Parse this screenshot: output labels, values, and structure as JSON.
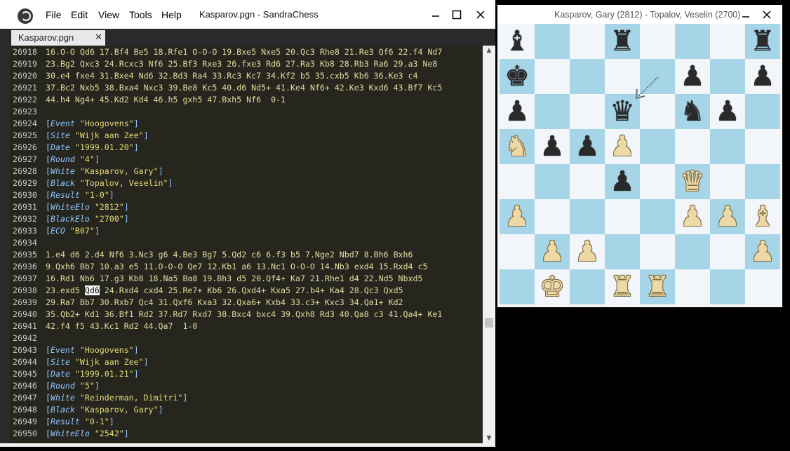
{
  "editor": {
    "title": "Kasparov.pgn - SandraChess",
    "menu": [
      "File",
      "Edit",
      "View",
      "Tools",
      "Help"
    ],
    "tab": {
      "label": "Kasparov.pgn",
      "close": "✕"
    },
    "lines": [
      {
        "n": "26918",
        "t": "16.O-O Qd6 17.Bf4 Be5 18.Rfe1 O-O-O 19.Bxe5 Nxe5 20.Qc3 Rhe8 21.Re3 Qf6 22.f4 Nd7"
      },
      {
        "n": "26919",
        "t": "23.Bg2 Qxc3 24.Rcxc3 Nf6 25.Bf3 Rxe3 26.fxe3 Rd6 27.Ra3 Kb8 28.Rb3 Ra6 29.a3 Ne8"
      },
      {
        "n": "26920",
        "t": "30.e4 fxe4 31.Bxe4 Nd6 32.Bd3 Ra4 33.Rc3 Kc7 34.Kf2 b5 35.cxb5 Kb6 36.Ke3 c4"
      },
      {
        "n": "26921",
        "t": "37.Bc2 Nxb5 38.Bxa4 Nxc3 39.Be8 Kc5 40.d6 Nd5+ 41.Ke4 Nf6+ 42.Ke3 Kxd6 43.Bf7 Kc5"
      },
      {
        "n": "26922",
        "t": "44.h4 Ng4+ 45.Kd2 Kd4 46.h5 gxh5 47.Bxh5 Nf6  0-1"
      },
      {
        "n": "26923",
        "t": ""
      },
      {
        "n": "26924",
        "tag": "Event",
        "val": "\"Hoogovens\""
      },
      {
        "n": "26925",
        "tag": "Site",
        "val": "\"Wijk aan Zee\""
      },
      {
        "n": "26926",
        "tag": "Date",
        "val": "\"1999.01.20\""
      },
      {
        "n": "26927",
        "tag": "Round",
        "val": "\"4\""
      },
      {
        "n": "26928",
        "tag": "White",
        "val": "\"Kasparov, Gary\""
      },
      {
        "n": "26929",
        "tag": "Black",
        "val": "\"Topalov, Veselin\""
      },
      {
        "n": "26930",
        "tag": "Result",
        "val": "\"1-0\""
      },
      {
        "n": "26931",
        "tag": "WhiteElo",
        "val": "\"2812\""
      },
      {
        "n": "26932",
        "tag": "BlackElo",
        "val": "\"2700\""
      },
      {
        "n": "26933",
        "tag": "ECO",
        "val": "\"B07\""
      },
      {
        "n": "26934",
        "t": ""
      },
      {
        "n": "26935",
        "t": "1.e4 d6 2.d4 Nf6 3.Nc3 g6 4.Be3 Bg7 5.Qd2 c6 6.f3 b5 7.Nge2 Nbd7 8.Bh6 Bxh6"
      },
      {
        "n": "26936",
        "t": "9.Qxh6 Bb7 10.a3 e5 11.O-O-O Qe7 12.Kb1 a6 13.Nc1 O-O-O 14.Nb3 exd4 15.Rxd4 c5"
      },
      {
        "n": "26937",
        "t": "16.Rd1 Nb6 17.g3 Kb8 18.Na5 Ba8 19.Bh3 d5 20.Qf4+ Ka7 21.Rhe1 d4 22.Nd5 Nbxd5"
      },
      {
        "n": "26938",
        "pre": "23.exd5 ",
        "hl": "Qd6",
        "post": " 24.Rxd4 cxd4 25.Re7+ Kb6 26.Qxd4+ Kxa5 27.b4+ Ka4 28.Qc3 Qxd5"
      },
      {
        "n": "26939",
        "t": "29.Ra7 Bb7 30.Rxb7 Qc4 31.Qxf6 Kxa3 32.Qxa6+ Kxb4 33.c3+ Kxc3 34.Qa1+ Kd2"
      },
      {
        "n": "26940",
        "t": "35.Qb2+ Kd1 36.Bf1 Rd2 37.Rd7 Rxd7 38.Bxc4 bxc4 39.Qxh8 Rd3 40.Qa8 c3 41.Qa4+ Ke1"
      },
      {
        "n": "26941",
        "t": "42.f4 f5 43.Kc1 Rd2 44.Qa7  1-0"
      },
      {
        "n": "26942",
        "t": ""
      },
      {
        "n": "26943",
        "tag": "Event",
        "val": "\"Hoogovens\""
      },
      {
        "n": "26944",
        "tag": "Site",
        "val": "\"Wijk aan Zee\""
      },
      {
        "n": "26945",
        "tag": "Date",
        "val": "\"1999.01.21\""
      },
      {
        "n": "26946",
        "tag": "Round",
        "val": "\"5\""
      },
      {
        "n": "26947",
        "tag": "White",
        "val": "\"Reinderman, Dimitri\""
      },
      {
        "n": "26948",
        "tag": "Black",
        "val": "\"Kasparov, Gary\""
      },
      {
        "n": "26949",
        "tag": "Result",
        "val": "\"0-1\""
      },
      {
        "n": "26950",
        "tag": "WhiteElo",
        "val": "\"2542\""
      }
    ]
  },
  "board": {
    "title": "Kasparov, Gary (2812) - Topalov, Veselin (2700)",
    "rows": [
      "b.r...r.r",
      "k...p.p",
      "p..q.np.",
      "Nppp....",
      "...p.Q..",
      "P...PPB",
      ".PP....P",
      ".K.RR..."
    ],
    "position": [
      [
        "bB",
        "",
        "",
        "bR",
        "",
        "",
        "",
        "bR"
      ],
      [
        "bK",
        "",
        "",
        "",
        "",
        "bP",
        "",
        "bP"
      ],
      [
        "bP",
        "",
        "",
        "bQ",
        "",
        "bN",
        "bP",
        ""
      ],
      [
        "wN",
        "bP",
        "bP",
        "wP",
        "",
        "",
        "",
        ""
      ],
      [
        "",
        "",
        "",
        "bP",
        "",
        "wQ",
        "",
        ""
      ],
      [
        "wP",
        "",
        "",
        "",
        "",
        "wP",
        "wP",
        "wB"
      ],
      [
        "",
        "wP",
        "wP",
        "",
        "",
        "",
        "",
        "wP"
      ],
      [
        "",
        "wK",
        "",
        "wR",
        "wR",
        "",
        "",
        ""
      ]
    ],
    "colors": {
      "light": "#f2f6fa",
      "dark": "#a6d5e8"
    }
  },
  "icons": {
    "minimize": "minimize-icon",
    "maximize": "maximize-icon",
    "close": "close-icon"
  }
}
